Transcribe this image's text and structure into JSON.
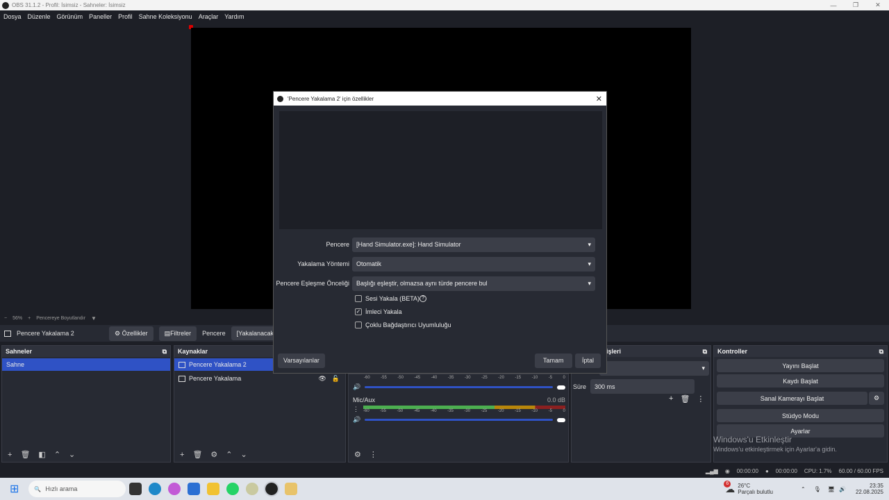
{
  "window": {
    "title": "OBS 31.1.2 - Profil: İsimsiz - Sahneler: İsimsiz"
  },
  "menu": [
    "Dosya",
    "Düzenle",
    "Görünüm",
    "Paneller",
    "Profil",
    "Sahne Koleksiyonu",
    "Araçlar",
    "Yardım"
  ],
  "zoom": {
    "minus": "−",
    "value": "56%",
    "plus": "+",
    "fit_label": "Pencereye Boyutlandır"
  },
  "source_bar": {
    "source_name": "Pencere Yakalama 2",
    "properties": "Özellikler",
    "filters": "Filtreler",
    "window_label": "Pencere",
    "window_value": "[Yakalanacak bir p"
  },
  "scenes": {
    "title": "Sahneler",
    "items": [
      "Sahne"
    ]
  },
  "sources": {
    "title": "Kaynaklar",
    "items": [
      "Pencere Yakalama 2",
      "Pencere Yakalama"
    ]
  },
  "mixer": {
    "ticks": [
      "-60",
      "-55",
      "-50",
      "-45",
      "-40",
      "-35",
      "-30",
      "-25",
      "-20",
      "-15",
      "-10",
      "-5",
      "0"
    ],
    "track2_name": "Mic/Aux",
    "track2_db": "0.0 dB"
  },
  "transitions": {
    "title_partial": "işleri",
    "duration_label": "Süre",
    "duration_value": "300 ms"
  },
  "controls": {
    "title": "Kontroller",
    "buttons": [
      "Yayını Başlat",
      "Kaydı Başlat",
      "Sanal Kamerayı Başlat",
      "Stüdyo Modu",
      "Ayarlar"
    ]
  },
  "activation": {
    "title": "Windows'u Etkinleştir",
    "subtitle": "Windows'u etkinleştirmek için Ayarlar'a gidin."
  },
  "status": {
    "time1": "00:00:00",
    "time2": "00:00:00",
    "cpu": "CPU: 1.7%",
    "fps": "60.00 / 60.00 FPS"
  },
  "taskbar": {
    "search": "Hızlı arama",
    "weather_temp": "26°C",
    "weather_desc": "Parçalı bulutlu",
    "weather_badge": "6",
    "clock": "23:35",
    "date": "22.08.2025"
  },
  "dialog": {
    "title": "'Pencere Yakalama 2' için özellikler",
    "fields": [
      {
        "label": "Pencere",
        "value": "[Hand Simulator.exe]: Hand Simulator"
      },
      {
        "label": "Yakalama Yöntemi",
        "value": "Otomatik"
      },
      {
        "label": "Pencere Eşleşme Önceliği",
        "value": "Başlığı eşleştir, olmazsa aynı türde pencere bul"
      }
    ],
    "checkboxes": [
      {
        "label": "Sesi Yakala (BETA)",
        "checked": false
      },
      {
        "label": "İmleci Yakala",
        "checked": true
      },
      {
        "label": "Çoklu Bağdaştırıcı Uyumluluğu",
        "checked": false
      }
    ],
    "defaults": "Varsayılanlar",
    "ok": "Tamam",
    "cancel": "İptal"
  }
}
